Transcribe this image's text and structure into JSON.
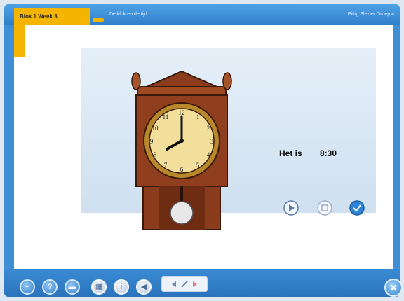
{
  "header": {
    "lesson_tab": "Blok 1 Week 3",
    "topic": "De klok en de tijd",
    "right_info": "Pittig Plezier Groep 4"
  },
  "exercise": {
    "prompt": "Het is",
    "time": "8:30",
    "clock_reading": "8:30"
  },
  "toolbar": {
    "buttons": [
      {
        "icon": "minus-icon",
        "glyph": "−"
      },
      {
        "icon": "help-icon",
        "glyph": "?"
      },
      {
        "icon": "keyboard-icon",
        "glyph": "▬"
      },
      {
        "icon": "grid-icon",
        "glyph": "▦"
      },
      {
        "icon": "info-icon",
        "glyph": "i"
      },
      {
        "icon": "sound-icon",
        "glyph": "◀"
      }
    ],
    "close_glyph": "✕"
  },
  "colors": {
    "frame": "#3f8fd6",
    "tab_orange": "#f4b400",
    "clock_wood": "#8a3c1c",
    "clock_face": "#f2df9c"
  }
}
